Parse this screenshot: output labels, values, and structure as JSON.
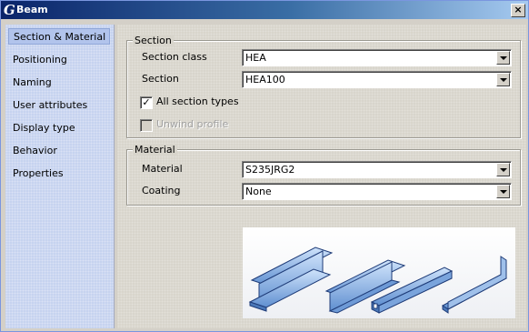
{
  "window": {
    "logo": "G",
    "title": "Beam",
    "close_glyph": "×"
  },
  "sidebar": {
    "items": [
      {
        "label": "Section & Material",
        "active": true
      },
      {
        "label": "Positioning"
      },
      {
        "label": "Naming"
      },
      {
        "label": "User attributes"
      },
      {
        "label": "Display type"
      },
      {
        "label": "Behavior"
      },
      {
        "label": "Properties"
      }
    ]
  },
  "section": {
    "legend": "Section",
    "class_label": "Section class",
    "class_value": "HEA",
    "section_label": "Section",
    "section_value": "HEA100",
    "all_types_label": "All section types",
    "all_types_checked": true,
    "all_types_glyph": "✓",
    "unwind_label": "Unwind profile",
    "unwind_checked": false
  },
  "material": {
    "legend": "Material",
    "material_label": "Material",
    "material_value": "S235JRG2",
    "coating_label": "Coating",
    "coating_value": "None"
  },
  "preview": {
    "icon": "beam-profiles-illustration",
    "colors": {
      "steel": "#8fb8e8",
      "edge": "#1f3c78"
    }
  }
}
